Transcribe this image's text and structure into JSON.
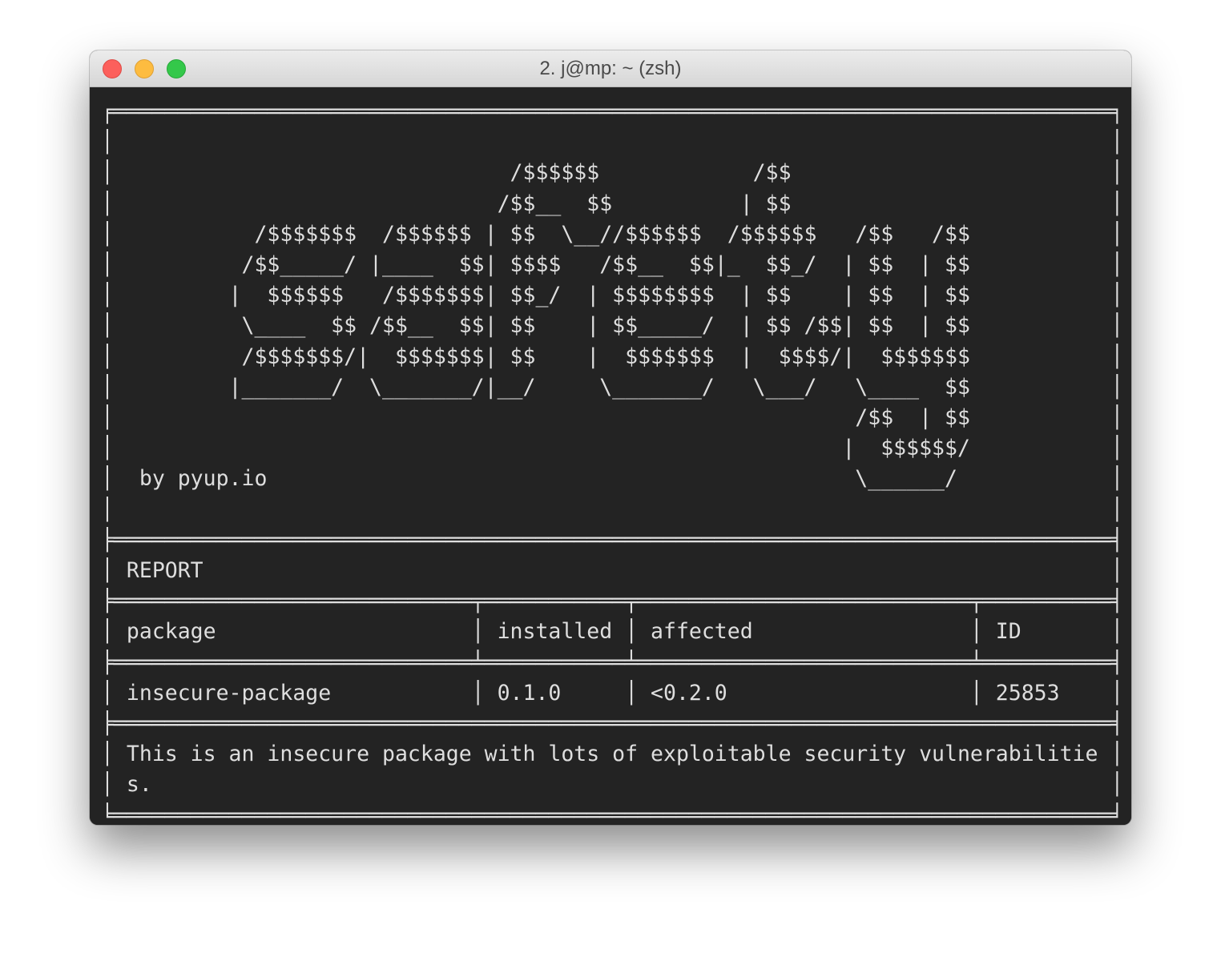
{
  "window": {
    "title": "2. j@mp: ~ (zsh)"
  },
  "terminal": {
    "lines": [
      "╒══════════════════════════════════════════════════════════════════════════════╕",
      "│                                                                              │",
      "│                               /$$$$$$            /$$                         │",
      "│                              /$$__  $$          | $$                         │",
      "│           /$$$$$$$  /$$$$$$ | $$  \\__//$$$$$$  /$$$$$$   /$$   /$$           │",
      "│          /$$_____/ |____  $$| $$$$   /$$__  $$|_  $$_/  | $$  | $$           │",
      "│         |  $$$$$$   /$$$$$$$| $$_/  | $$$$$$$$  | $$    | $$  | $$           │",
      "│          \\____  $$ /$$__  $$| $$    | $$_____/  | $$ /$$| $$  | $$           │",
      "│          /$$$$$$$/|  $$$$$$$| $$    |  $$$$$$$  |  $$$$/|  $$$$$$$           │",
      "│         |_______/  \\_______/|__/     \\_______/   \\___/   \\____  $$           │",
      "│                                                          /$$  | $$           │",
      "│                                                         |  $$$$$$/           │",
      "│  by pyup.io                                              \\______/            │",
      "│                                                                              │",
      "╞══════════════════════════════════════════════════════════════════════════════╡",
      "│ REPORT                                                                       │",
      "╞════════════════════════════╤═══════════╤══════════════════════════╤══════════╡",
      "│ package                    │ installed │ affected                 │ ID       │",
      "╞════════════════════════════╧═══════════╧══════════════════════════╧══════════╡",
      "│ insecure-package           │ 0.1.0     │ <0.2.0                   │ 25853    │",
      "╞══════════════════════════════════════════════════════════════════════════════╡",
      "│ This is an insecure package with lots of exploitable security vulnerabilitie │",
      "│ s.                                                                           │",
      "╘══════════════════════════════════════════════════════════════════════════════╛"
    ]
  }
}
